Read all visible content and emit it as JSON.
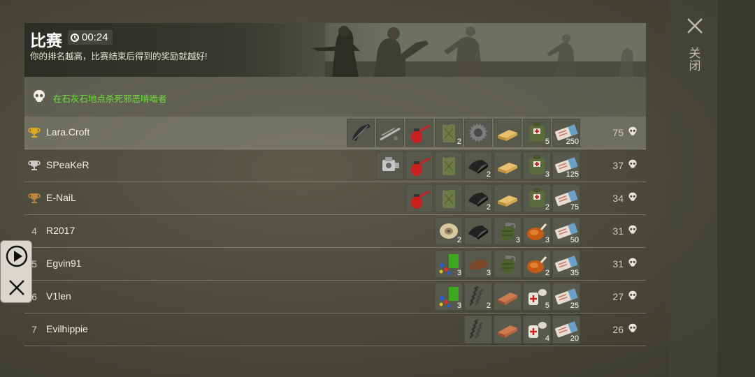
{
  "header": {
    "title": "比赛",
    "timer": "00:24",
    "subtitle": "你的排名越高，比赛结束后得到的奖励就越好!"
  },
  "objective": {
    "text": "在石灰石地点杀死邪恶啃啮者",
    "color": "#6fe03a"
  },
  "side": {
    "close_label": "关闭"
  },
  "rows": [
    {
      "rank": "",
      "trophy": "gold",
      "name": "Lara.Croft",
      "score": "75",
      "items": [
        {
          "icon": "metal-sheet-icon",
          "qty": ""
        },
        {
          "icon": "pipe-parts-icon",
          "qty": ""
        },
        {
          "icon": "oil-can-icon",
          "qty": ""
        },
        {
          "icon": "jerrycan-icon",
          "qty": "2"
        },
        {
          "icon": "gear-icon",
          "qty": ""
        },
        {
          "icon": "gold-bars-icon",
          "qty": ""
        },
        {
          "icon": "medical-backpack-icon",
          "qty": "5"
        },
        {
          "icon": "ticket-icon",
          "qty": "250"
        }
      ]
    },
    {
      "rank": "",
      "trophy": "silver",
      "name": "SPeaKeR",
      "score": "37",
      "items": [
        {
          "icon": "engine-part-icon",
          "qty": ""
        },
        {
          "icon": "oil-can-icon",
          "qty": ""
        },
        {
          "icon": "jerrycan-icon",
          "qty": ""
        },
        {
          "icon": "fabric-icon",
          "qty": "2"
        },
        {
          "icon": "gold-bars-icon",
          "qty": ""
        },
        {
          "icon": "medical-backpack-icon",
          "qty": "3"
        },
        {
          "icon": "ticket-icon",
          "qty": "125"
        }
      ]
    },
    {
      "rank": "",
      "trophy": "bronze",
      "name": "E-NaiL",
      "score": "34",
      "items": [
        {
          "icon": "oil-can-icon",
          "qty": ""
        },
        {
          "icon": "jerrycan-icon",
          "qty": ""
        },
        {
          "icon": "fabric-icon",
          "qty": "2"
        },
        {
          "icon": "gold-bars-icon",
          "qty": ""
        },
        {
          "icon": "medical-backpack-icon",
          "qty": "2"
        },
        {
          "icon": "ticket-icon",
          "qty": "75"
        }
      ]
    },
    {
      "rank": "4",
      "trophy": "",
      "name": "R2017",
      "score": "31",
      "items": [
        {
          "icon": "wire-spool-icon",
          "qty": "2"
        },
        {
          "icon": "fabric-icon",
          "qty": ""
        },
        {
          "icon": "grenade-icon",
          "qty": "3"
        },
        {
          "icon": "roast-chicken-icon",
          "qty": "3"
        },
        {
          "icon": "ticket-icon",
          "qty": "50"
        }
      ]
    },
    {
      "rank": "5",
      "trophy": "",
      "name": "Egvin91",
      "score": "31",
      "items": [
        {
          "icon": "circuit-parts-icon",
          "qty": "3"
        },
        {
          "icon": "leather-icon",
          "qty": "3"
        },
        {
          "icon": "grenade-icon",
          "qty": ""
        },
        {
          "icon": "roast-chicken-icon",
          "qty": "2"
        },
        {
          "icon": "ticket-icon",
          "qty": "35"
        }
      ]
    },
    {
      "rank": "6",
      "trophy": "",
      "name": "V1len",
      "score": "27",
      "items": [
        {
          "icon": "circuit-parts-icon",
          "qty": "3"
        },
        {
          "icon": "spring-icon",
          "qty": "2"
        },
        {
          "icon": "copper-bar-icon",
          "qty": ""
        },
        {
          "icon": "bandage-icon",
          "qty": "5"
        },
        {
          "icon": "ticket-icon",
          "qty": "25"
        }
      ]
    },
    {
      "rank": "7",
      "trophy": "",
      "name": "Evilhippie",
      "score": "26",
      "items": [
        {
          "icon": "spring-icon",
          "qty": ""
        },
        {
          "icon": "copper-bar-icon",
          "qty": ""
        },
        {
          "icon": "bandage-icon",
          "qty": "4"
        },
        {
          "icon": "ticket-icon",
          "qty": "20"
        }
      ]
    }
  ],
  "colors": {
    "gold": "#e0a81c",
    "silver": "#c9c9c9",
    "bronze": "#b98442",
    "objective_text": "#6fe03a"
  }
}
